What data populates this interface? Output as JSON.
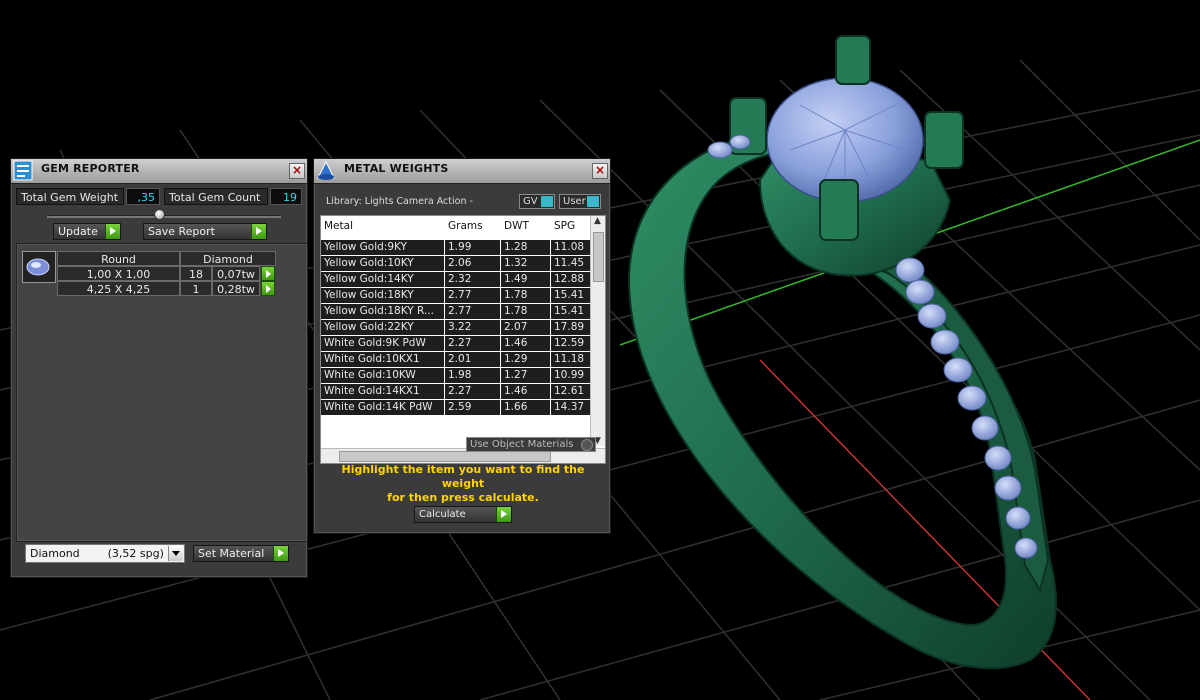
{
  "gem_reporter": {
    "title": "GEM REPORTER",
    "total_weight_label": "Total Gem Weight",
    "total_weight_value": ",35",
    "total_count_label": "Total Gem Count",
    "total_count_value": "19",
    "update_label": "Update",
    "save_report_label": "Save Report",
    "col_shape": "Round",
    "col_material": "Diamond",
    "rows": [
      {
        "size": "1,00 X 1,00",
        "count": "18",
        "weight": "0,07tw"
      },
      {
        "size": "4,25 X 4,25",
        "count": "1",
        "weight": "0,28tw"
      }
    ],
    "material_select": "Diamond        (3,52 spg)",
    "set_material_label": "Set Material"
  },
  "metal_weights": {
    "title": "METAL WEIGHTS",
    "library_label": "Library: Lights Camera Action -",
    "gv_label": "GV",
    "user_label": "User",
    "columns": [
      "Metal",
      "Grams",
      "DWT",
      "SPG"
    ],
    "rows": [
      {
        "metal": "Yellow Gold:9KY",
        "grams": "1.99",
        "dwt": "1.28",
        "spg": "11.08"
      },
      {
        "metal": "Yellow Gold:10KY",
        "grams": "2.06",
        "dwt": "1.32",
        "spg": "11.45"
      },
      {
        "metal": "Yellow Gold:14KY",
        "grams": "2.32",
        "dwt": "1.49",
        "spg": "12.88"
      },
      {
        "metal": "Yellow Gold:18KY",
        "grams": "2.77",
        "dwt": "1.78",
        "spg": "15.41"
      },
      {
        "metal": "Yellow Gold:18KY R...",
        "grams": "2.77",
        "dwt": "1.78",
        "spg": "15.41"
      },
      {
        "metal": "Yellow Gold:22KY",
        "grams": "3.22",
        "dwt": "2.07",
        "spg": "17.89"
      },
      {
        "metal": "White Gold:9K PdW",
        "grams": "2.27",
        "dwt": "1.46",
        "spg": "12.59"
      },
      {
        "metal": "White Gold:10KX1",
        "grams": "2.01",
        "dwt": "1.29",
        "spg": "11.18"
      },
      {
        "metal": "White Gold:10KW",
        "grams": "1.98",
        "dwt": "1.27",
        "spg": "10.99"
      },
      {
        "metal": "White Gold:14KX1",
        "grams": "2.27",
        "dwt": "1.46",
        "spg": "12.61"
      },
      {
        "metal": "White Gold:14K PdW",
        "grams": "2.59",
        "dwt": "1.66",
        "spg": "14.37"
      }
    ],
    "use_object_materials_label": "Use Object Materials",
    "hint_line1": "Highlight the item you want to find the weight",
    "hint_line2": "for then press calculate.",
    "calculate_label": "Calculate"
  },
  "colors": {
    "ring": "#1f6b4c",
    "gem": "#8aa0dc",
    "grid": "#2c2c2c",
    "axis_green": "#35b62a",
    "axis_red": "#c43636",
    "accent_cyan": "#3ad6f2",
    "go_green": "#5bb826",
    "hint_yellow": "#ffd400"
  }
}
